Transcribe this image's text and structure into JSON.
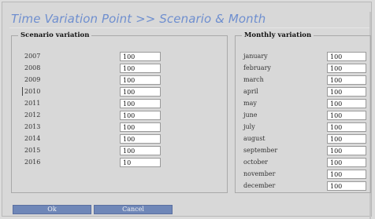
{
  "title": "Time Variation Point >> Scenario & Month",
  "scenario": {
    "legend": "Scenario variation",
    "rows": [
      {
        "label": "2007",
        "value": "100"
      },
      {
        "label": "2008",
        "value": "100"
      },
      {
        "label": "2009",
        "value": "100"
      },
      {
        "label": "2010",
        "value": "100"
      },
      {
        "label": "2011",
        "value": "100"
      },
      {
        "label": "2012",
        "value": "100"
      },
      {
        "label": "2013",
        "value": "100"
      },
      {
        "label": "2014",
        "value": "100"
      },
      {
        "label": "2015",
        "value": "100"
      },
      {
        "label": "2016",
        "value": "10"
      }
    ]
  },
  "monthly": {
    "legend": "Monthly variation",
    "rows": [
      {
        "label": "january",
        "value": "100"
      },
      {
        "label": "february",
        "value": "100"
      },
      {
        "label": "march",
        "value": "100"
      },
      {
        "label": "april",
        "value": "100"
      },
      {
        "label": "may",
        "value": "100"
      },
      {
        "label": "june",
        "value": "100"
      },
      {
        "label": "july",
        "value": "100"
      },
      {
        "label": "august",
        "value": "100"
      },
      {
        "label": "september",
        "value": "100"
      },
      {
        "label": "october",
        "value": "100"
      },
      {
        "label": "november",
        "value": "100"
      },
      {
        "label": "december",
        "value": "100"
      }
    ]
  },
  "buttons": {
    "ok": "Ok",
    "cancel": "Cancel"
  }
}
